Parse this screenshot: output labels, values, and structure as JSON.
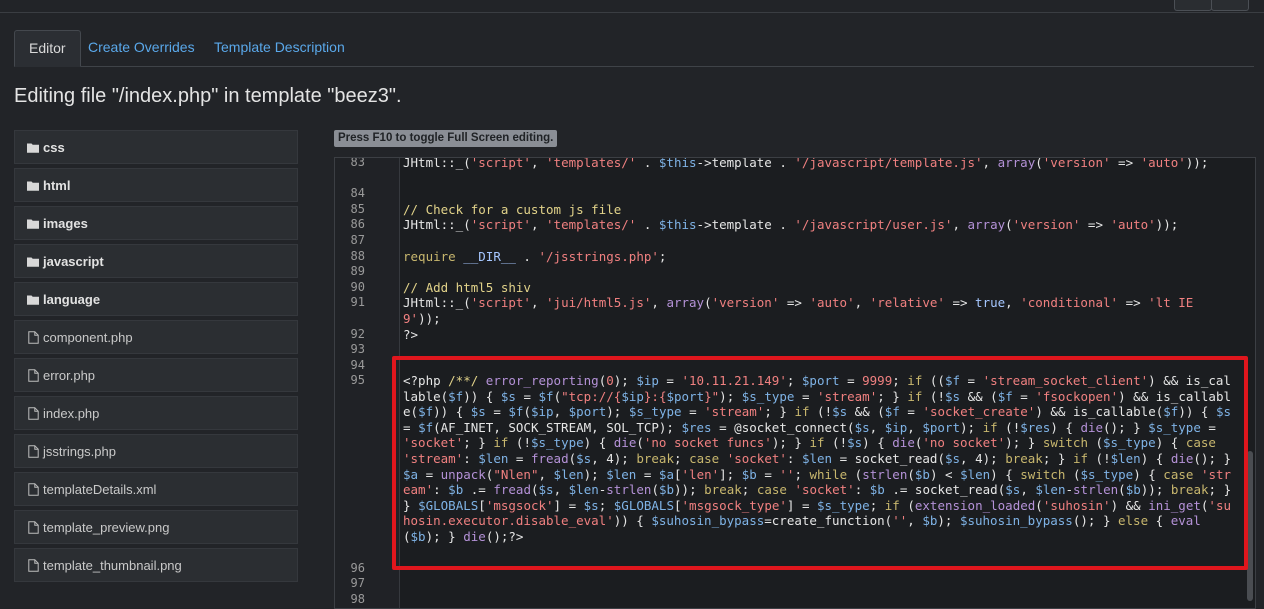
{
  "tabs": [
    {
      "label": "Editor",
      "active": true
    },
    {
      "label": "Create Overrides",
      "active": false
    },
    {
      "label": "Template Description",
      "active": false
    }
  ],
  "heading": "Editing file \"/index.php\" in template \"beez3\".",
  "tree": [
    {
      "label": "css",
      "type": "folder"
    },
    {
      "label": "html",
      "type": "folder"
    },
    {
      "label": "images",
      "type": "folder"
    },
    {
      "label": "javascript",
      "type": "folder"
    },
    {
      "label": "language",
      "type": "folder"
    },
    {
      "label": "component.php",
      "type": "file"
    },
    {
      "label": "error.php",
      "type": "file"
    },
    {
      "label": "index.php",
      "type": "file"
    },
    {
      "label": "jsstrings.php",
      "type": "file"
    },
    {
      "label": "templateDetails.xml",
      "type": "file"
    },
    {
      "label": "template_preview.png",
      "type": "file"
    },
    {
      "label": "template_thumbnail.png",
      "type": "file"
    }
  ],
  "notice": "Press F10 to toggle Full Screen editing.",
  "editor": {
    "line_numbers": [
      "83",
      "84",
      "85",
      "86",
      "87",
      "88",
      "89",
      "90",
      "91",
      "92",
      "93",
      "94",
      "95",
      "96",
      "97",
      "98"
    ]
  },
  "colors": {
    "link": "#5aa8ea",
    "highlight": "#e0161d"
  }
}
